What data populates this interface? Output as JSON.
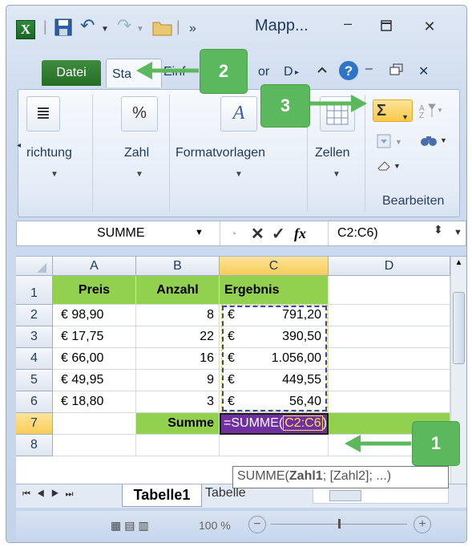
{
  "titlebar": {
    "title": "Mapp...",
    "more_glyph": "»"
  },
  "tabs": {
    "datei": "Datei",
    "start": "Sta",
    "einfuegen": "Einf",
    "other1": "or",
    "other2": "D"
  },
  "ribbon": {
    "richtung": "richtung",
    "zahl": "Zahl",
    "zahl_icon_text": "%",
    "formatvorlagen": "Formatvorlagen",
    "zellen": "Zellen",
    "bearbeiten": "Bearbeiten",
    "sigma": "Σ"
  },
  "formula_bar": {
    "name_box": "SUMME",
    "fx": "fx",
    "value": "C2:C6)"
  },
  "columns": [
    "A",
    "B",
    "C",
    "D"
  ],
  "rows": [
    "1",
    "2",
    "3",
    "4",
    "5",
    "6",
    "7",
    "8"
  ],
  "table": {
    "headers": [
      "Preis",
      "Anzahl",
      "Ergebnis"
    ],
    "data": [
      {
        "preis": "€ 98,90",
        "anzahl": "8",
        "euro": "€",
        "ergebnis": "791,20"
      },
      {
        "preis": "€ 17,75",
        "anzahl": "22",
        "euro": "€",
        "ergebnis": "390,50"
      },
      {
        "preis": "€ 66,00",
        "anzahl": "16",
        "euro": "€",
        "ergebnis": "1.056,00"
      },
      {
        "preis": "€ 49,95",
        "anzahl": "9",
        "euro": "€",
        "ergebnis": "449,55"
      },
      {
        "preis": "€ 18,80",
        "anzahl": "3",
        "euro": "€",
        "ergebnis": "56,40"
      }
    ],
    "summe_label": "Summe",
    "formula_prefix": "=SUMME(",
    "formula_range": "C2:C6",
    "formula_suffix": ")"
  },
  "tooltip": {
    "fn": "SUMME(",
    "arg1": "Zahl1",
    "rest": "; [Zahl2]; ...)"
  },
  "sheet_tabs": {
    "active": "Tabelle1",
    "next": "Tabelle"
  },
  "status": {
    "zoom": "100 %"
  },
  "callouts": [
    "1",
    "2",
    "3"
  ],
  "colors": {
    "callout_green": "#5cb85c",
    "header_green": "#92d050",
    "range_highlight": "#7030a0"
  }
}
